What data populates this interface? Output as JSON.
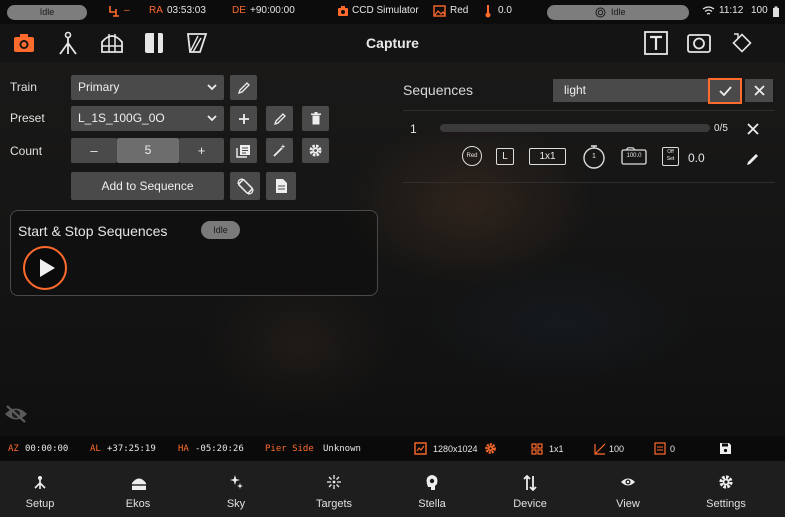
{
  "colors": {
    "accent": "#ff6b2c",
    "panel": "#4a4a4a",
    "background": "#121212"
  },
  "status_bar": {
    "mount_status": "Idle",
    "tracking": "–",
    "ra_label": "RA",
    "ra_value": "03:53:03",
    "de_label": "DE",
    "de_value": "+90:00:00",
    "camera": "CCD Simulator",
    "filter": "Red",
    "temperature": "0.0",
    "focuser_status": "Idle",
    "clock": "11:12",
    "battery": "100"
  },
  "toolbar": {
    "title": "Capture",
    "icons": [
      "camera-icon",
      "focus-tripod-icon",
      "dome-icon",
      "guide-book-icon",
      "flat-panel-icon"
    ],
    "right_icons": [
      "text-overlay-icon",
      "camera-frame-icon",
      "rotate-icon"
    ]
  },
  "capture": {
    "train_label": "Train",
    "train_value": "Primary",
    "preset_label": "Preset",
    "preset_value": "L_1S_100G_0O",
    "count_label": "Count",
    "count_minus": "–",
    "count_value": "5",
    "count_plus": "+",
    "add_to_sequence": "Add to Sequence"
  },
  "sequence_control": {
    "title": "Start & Stop Sequences",
    "status": "Idle"
  },
  "sequences": {
    "heading": "Sequences",
    "search_value": "light",
    "items": [
      {
        "index": "1",
        "progress": "0/5",
        "progress_fraction": 0,
        "filter": "Red",
        "type": "L",
        "binning": "1x1",
        "exposure": "1",
        "gain": "100.0",
        "offset_top": "Off",
        "offset_bottom": "Set",
        "offset_value": "0.0"
      }
    ]
  },
  "coord_bar": {
    "az_label": "AZ",
    "az_value": "00:00:00",
    "al_label": "AL",
    "al_value": "+37:25:19",
    "ha_label": "HA",
    "ha_value": "-05:20:26",
    "pier_label": "Pier Side",
    "pier_value": "Unknown",
    "resolution": "1280x1024",
    "binning": "1x1",
    "gain": "100",
    "offset": "0"
  },
  "bottom_nav": [
    {
      "label": "Setup",
      "icon": "setup-icon"
    },
    {
      "label": "Ekos",
      "icon": "ekos-icon"
    },
    {
      "label": "Sky",
      "icon": "sky-icon"
    },
    {
      "label": "Targets",
      "icon": "targets-icon"
    },
    {
      "label": "Stella",
      "icon": "stella-icon"
    },
    {
      "label": "Device",
      "icon": "device-icon"
    },
    {
      "label": "View",
      "icon": "view-icon"
    },
    {
      "label": "Settings",
      "icon": "settings-icon"
    }
  ]
}
